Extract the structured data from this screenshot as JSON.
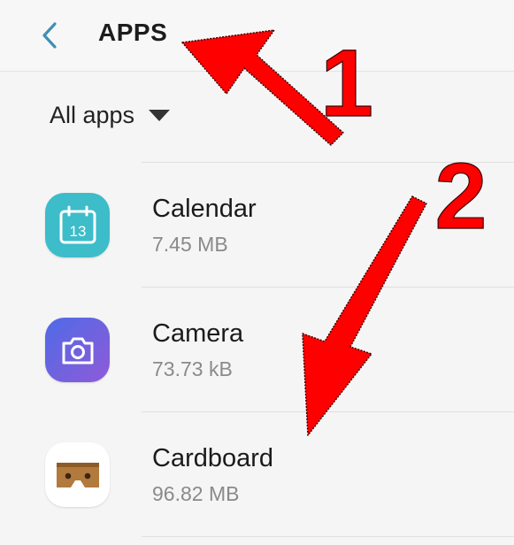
{
  "header": {
    "title": "APPS",
    "back_icon": "chevron-left-icon",
    "accent_color": "#3f8fb5"
  },
  "filter": {
    "label": "All apps",
    "icon": "caret-down-icon"
  },
  "apps": [
    {
      "name": "Calendar",
      "size": "7.45 MB",
      "icon": "calendar-icon",
      "icon_day": "13",
      "color": "#3dbcc9"
    },
    {
      "name": "Camera",
      "size": "73.73 kB",
      "icon": "camera-icon",
      "color": "#6a5ce0"
    },
    {
      "name": "Cardboard",
      "size": "96.82 MB",
      "icon": "cardboard-icon",
      "color": "#b27a3c"
    }
  ],
  "annotations": {
    "label_1": "1",
    "label_2": "2",
    "color": "#ff0000"
  }
}
